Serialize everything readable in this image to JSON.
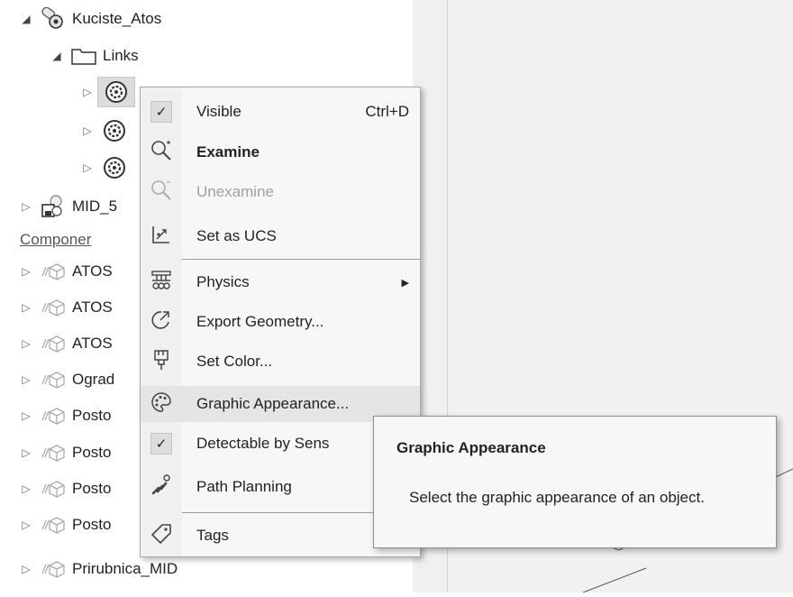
{
  "tree": {
    "root": {
      "label": "Kuciste_Atos"
    },
    "links": {
      "label": "Links"
    },
    "rows": [
      {
        "label": "MID_5"
      },
      {
        "label": "Componer"
      },
      {
        "label": "ATOS"
      },
      {
        "label": "ATOS"
      },
      {
        "label": "ATOS"
      },
      {
        "label": "Ograd"
      },
      {
        "label": "Posto"
      },
      {
        "label": "Posto"
      },
      {
        "label": "Posto"
      },
      {
        "label": "Posto"
      },
      {
        "label": "Prirubnica_MID"
      }
    ]
  },
  "context_menu": {
    "items": [
      {
        "label": "Visible",
        "shortcut": "Ctrl+D",
        "icon": "checkmark-icon"
      },
      {
        "label": "Examine",
        "icon": "examine-icon"
      },
      {
        "label": "Unexamine",
        "icon": "unexamine-icon"
      },
      {
        "label": "Set as UCS",
        "icon": "ucs-icon"
      },
      {
        "label": "Physics",
        "icon": "physics-icon"
      },
      {
        "label": "Export Geometry...",
        "icon": "export-geometry-icon"
      },
      {
        "label": "Set Color...",
        "icon": "set-color-icon"
      },
      {
        "label": "Graphic Appearance...",
        "icon": "palette-icon"
      },
      {
        "label": "Detectable by Sens",
        "icon": "checkmark-icon"
      },
      {
        "label": "Path Planning",
        "icon": "path-planning-icon"
      },
      {
        "label": "Tags",
        "icon": "tag-icon"
      }
    ]
  },
  "tooltip": {
    "title": "Graphic Appearance",
    "body": "Select the graphic appearance of an object."
  },
  "colors": {
    "menu_bg": "#f7f7f7",
    "highlight": "#e5e5e5",
    "disabled": "#a0a0a0",
    "splitter": "#f0f0f0"
  }
}
